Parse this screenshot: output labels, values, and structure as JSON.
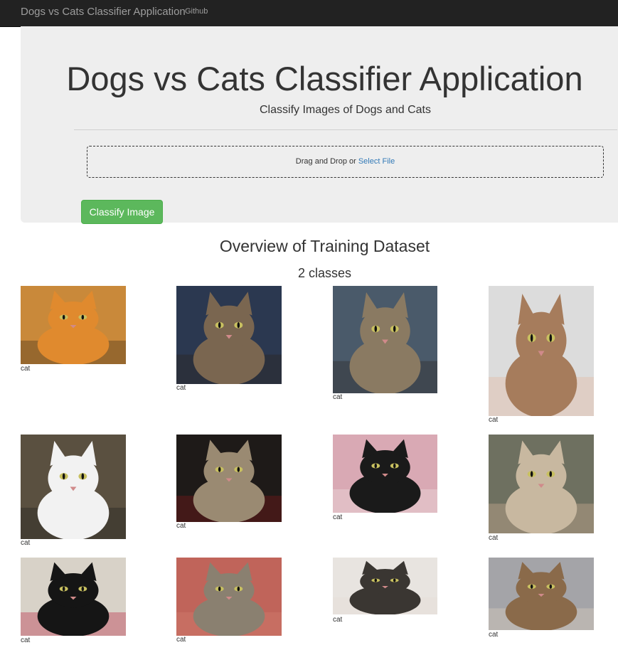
{
  "navbar": {
    "brand": "Dogs vs Cats Classifier Application",
    "link": "Github"
  },
  "jumbotron": {
    "title": "Dogs vs Cats Classifier Application",
    "subtitle": "Classify Images of Dogs and Cats",
    "dropzone_text": "Drag and Drop or ",
    "dropzone_link": "Select File",
    "button": "Classify Image"
  },
  "overview": {
    "title": "Overview of Training Dataset",
    "subtitle": "2 classes"
  },
  "gallery": [
    {
      "label": "cat",
      "bg": "#c9893a",
      "fur": "#e08a2e",
      "accent": "#3a2a1a"
    },
    {
      "label": "cat",
      "bg": "#2b3850",
      "fur": "#7a6650",
      "accent": "#2a2218"
    },
    {
      "label": "cat",
      "bg": "#4a5a6a",
      "fur": "#8a7a62",
      "accent": "#2a2620"
    },
    {
      "label": "cat",
      "bg": "#dcdcdc",
      "fur": "#a67c5c",
      "accent": "#e6b49a"
    },
    {
      "label": "cat",
      "bg": "#5a5040",
      "fur": "#f2f2f2",
      "accent": "#1e1e1e"
    },
    {
      "label": "cat",
      "bg": "#1e1a18",
      "fur": "#9a8a72",
      "accent": "#8a1a1a"
    },
    {
      "label": "cat",
      "bg": "#d9a9b4",
      "fur": "#1a1a1a",
      "accent": "#f0e6e6"
    },
    {
      "label": "cat",
      "bg": "#6e7060",
      "fur": "#c8b8a0",
      "accent": "#d9b59a"
    },
    {
      "label": "cat",
      "bg": "#d8d2c8",
      "fur": "#151515",
      "accent": "#b81e3a"
    },
    {
      "label": "cat",
      "bg": "#c0645a",
      "fur": "#8a8070",
      "accent": "#d58072"
    },
    {
      "label": "cat",
      "bg": "#e8e4e0",
      "fur": "#3a3632",
      "accent": "#e6ddd4"
    },
    {
      "label": "cat",
      "bg": "#a4a4a8",
      "fur": "#8a6a4a",
      "accent": "#e6d6c2"
    }
  ]
}
